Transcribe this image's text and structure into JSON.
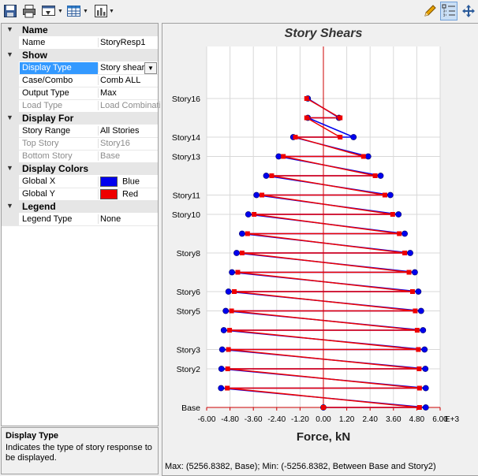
{
  "toolbar": {
    "left": [
      "save-icon",
      "print-icon",
      "display-options-icon",
      "table-icon",
      "chart-icon"
    ],
    "right": [
      "pencil-icon",
      "tree-options-icon",
      "move-icon"
    ]
  },
  "properties": {
    "name_cat": "Name",
    "name_label": "Name",
    "name_value": "StoryResp1",
    "show_cat": "Show",
    "display_type_label": "Display Type",
    "display_type_value": "Story shears",
    "case_combo_label": "Case/Combo",
    "case_combo_value": "Comb ALL",
    "output_type_label": "Output Type",
    "output_type_value": "Max",
    "load_type_label": "Load Type",
    "load_type_value": "Load Combination",
    "display_for_cat": "Display For",
    "story_range_label": "Story Range",
    "story_range_value": "All Stories",
    "top_story_label": "Top Story",
    "top_story_value": "Story16",
    "bottom_story_label": "Bottom Story",
    "bottom_story_value": "Base",
    "display_colors_cat": "Display Colors",
    "global_x_label": "Global X",
    "global_x_value": "Blue",
    "global_x_color": "#0000ee",
    "global_y_label": "Global Y",
    "global_y_value": "Red",
    "global_y_color": "#ee0000",
    "legend_cat": "Legend",
    "legend_type_label": "Legend Type",
    "legend_type_value": "None"
  },
  "help": {
    "title": "Display Type",
    "text": "Indicates the type of story response to be displayed."
  },
  "status": {
    "text": "Max: (5256.8382, Base);   Min: (-5256.8382, Between Base and Story2)"
  },
  "chart_data": {
    "type": "line",
    "title": "Story Shears",
    "xlabel": "Force, kN",
    "x_unit_suffix": "E+3",
    "xlim": [
      -6.0,
      6.0
    ],
    "x_ticks": [
      "-6.00",
      "-4.80",
      "-3.60",
      "-2.40",
      "-1.20",
      "0.00",
      "1.20",
      "2.40",
      "3.60",
      "4.80",
      "6.00"
    ],
    "grid": true,
    "level_labels": [
      "Base",
      "",
      "Story2",
      "Story3",
      "",
      "Story5",
      "Story6",
      "",
      "Story8",
      "",
      "Story10",
      "Story11",
      "",
      "Story13",
      "Story14",
      "",
      "Story16"
    ],
    "series": [
      {
        "color": "#0000ee",
        "marker": "circle",
        "points": [
          [
            0.0,
            0
          ],
          [
            5.26,
            0
          ],
          [
            -5.26,
            1
          ],
          [
            5.26,
            1
          ],
          [
            -5.24,
            2
          ],
          [
            5.24,
            2
          ],
          [
            -5.2,
            3
          ],
          [
            5.2,
            3
          ],
          [
            -5.12,
            4
          ],
          [
            5.12,
            4
          ],
          [
            -5.02,
            5
          ],
          [
            5.02,
            5
          ],
          [
            -4.88,
            6
          ],
          [
            4.88,
            6
          ],
          [
            -4.7,
            7
          ],
          [
            4.7,
            7
          ],
          [
            -4.46,
            8
          ],
          [
            4.46,
            8
          ],
          [
            -4.18,
            9
          ],
          [
            4.18,
            9
          ],
          [
            -3.86,
            10
          ],
          [
            3.86,
            10
          ],
          [
            -3.44,
            11
          ],
          [
            3.44,
            11
          ],
          [
            -2.94,
            12
          ],
          [
            2.94,
            12
          ],
          [
            -2.3,
            13
          ],
          [
            2.3,
            13
          ],
          [
            -1.55,
            14
          ],
          [
            1.55,
            14
          ],
          [
            -0.8,
            15
          ],
          [
            0.8,
            15
          ],
          [
            -0.8,
            16
          ]
        ]
      },
      {
        "color": "#ee0000",
        "marker": "square",
        "points": [
          [
            0.0,
            0
          ],
          [
            4.94,
            0
          ],
          [
            -4.94,
            1
          ],
          [
            4.94,
            1
          ],
          [
            -4.92,
            2
          ],
          [
            4.92,
            2
          ],
          [
            -4.88,
            3
          ],
          [
            4.88,
            3
          ],
          [
            -4.82,
            4
          ],
          [
            4.82,
            4
          ],
          [
            -4.72,
            5
          ],
          [
            4.72,
            5
          ],
          [
            -4.58,
            6
          ],
          [
            4.58,
            6
          ],
          [
            -4.4,
            7
          ],
          [
            4.4,
            7
          ],
          [
            -4.18,
            8
          ],
          [
            4.18,
            8
          ],
          [
            -3.9,
            9
          ],
          [
            3.9,
            9
          ],
          [
            -3.56,
            10
          ],
          [
            3.56,
            10
          ],
          [
            -3.16,
            11
          ],
          [
            3.16,
            11
          ],
          [
            -2.66,
            12
          ],
          [
            2.66,
            12
          ],
          [
            -2.06,
            13
          ],
          [
            2.06,
            13
          ],
          [
            -1.44,
            14
          ],
          [
            0.86,
            14
          ],
          [
            -0.86,
            15
          ],
          [
            0.86,
            15
          ],
          [
            -0.86,
            16
          ]
        ]
      }
    ]
  }
}
